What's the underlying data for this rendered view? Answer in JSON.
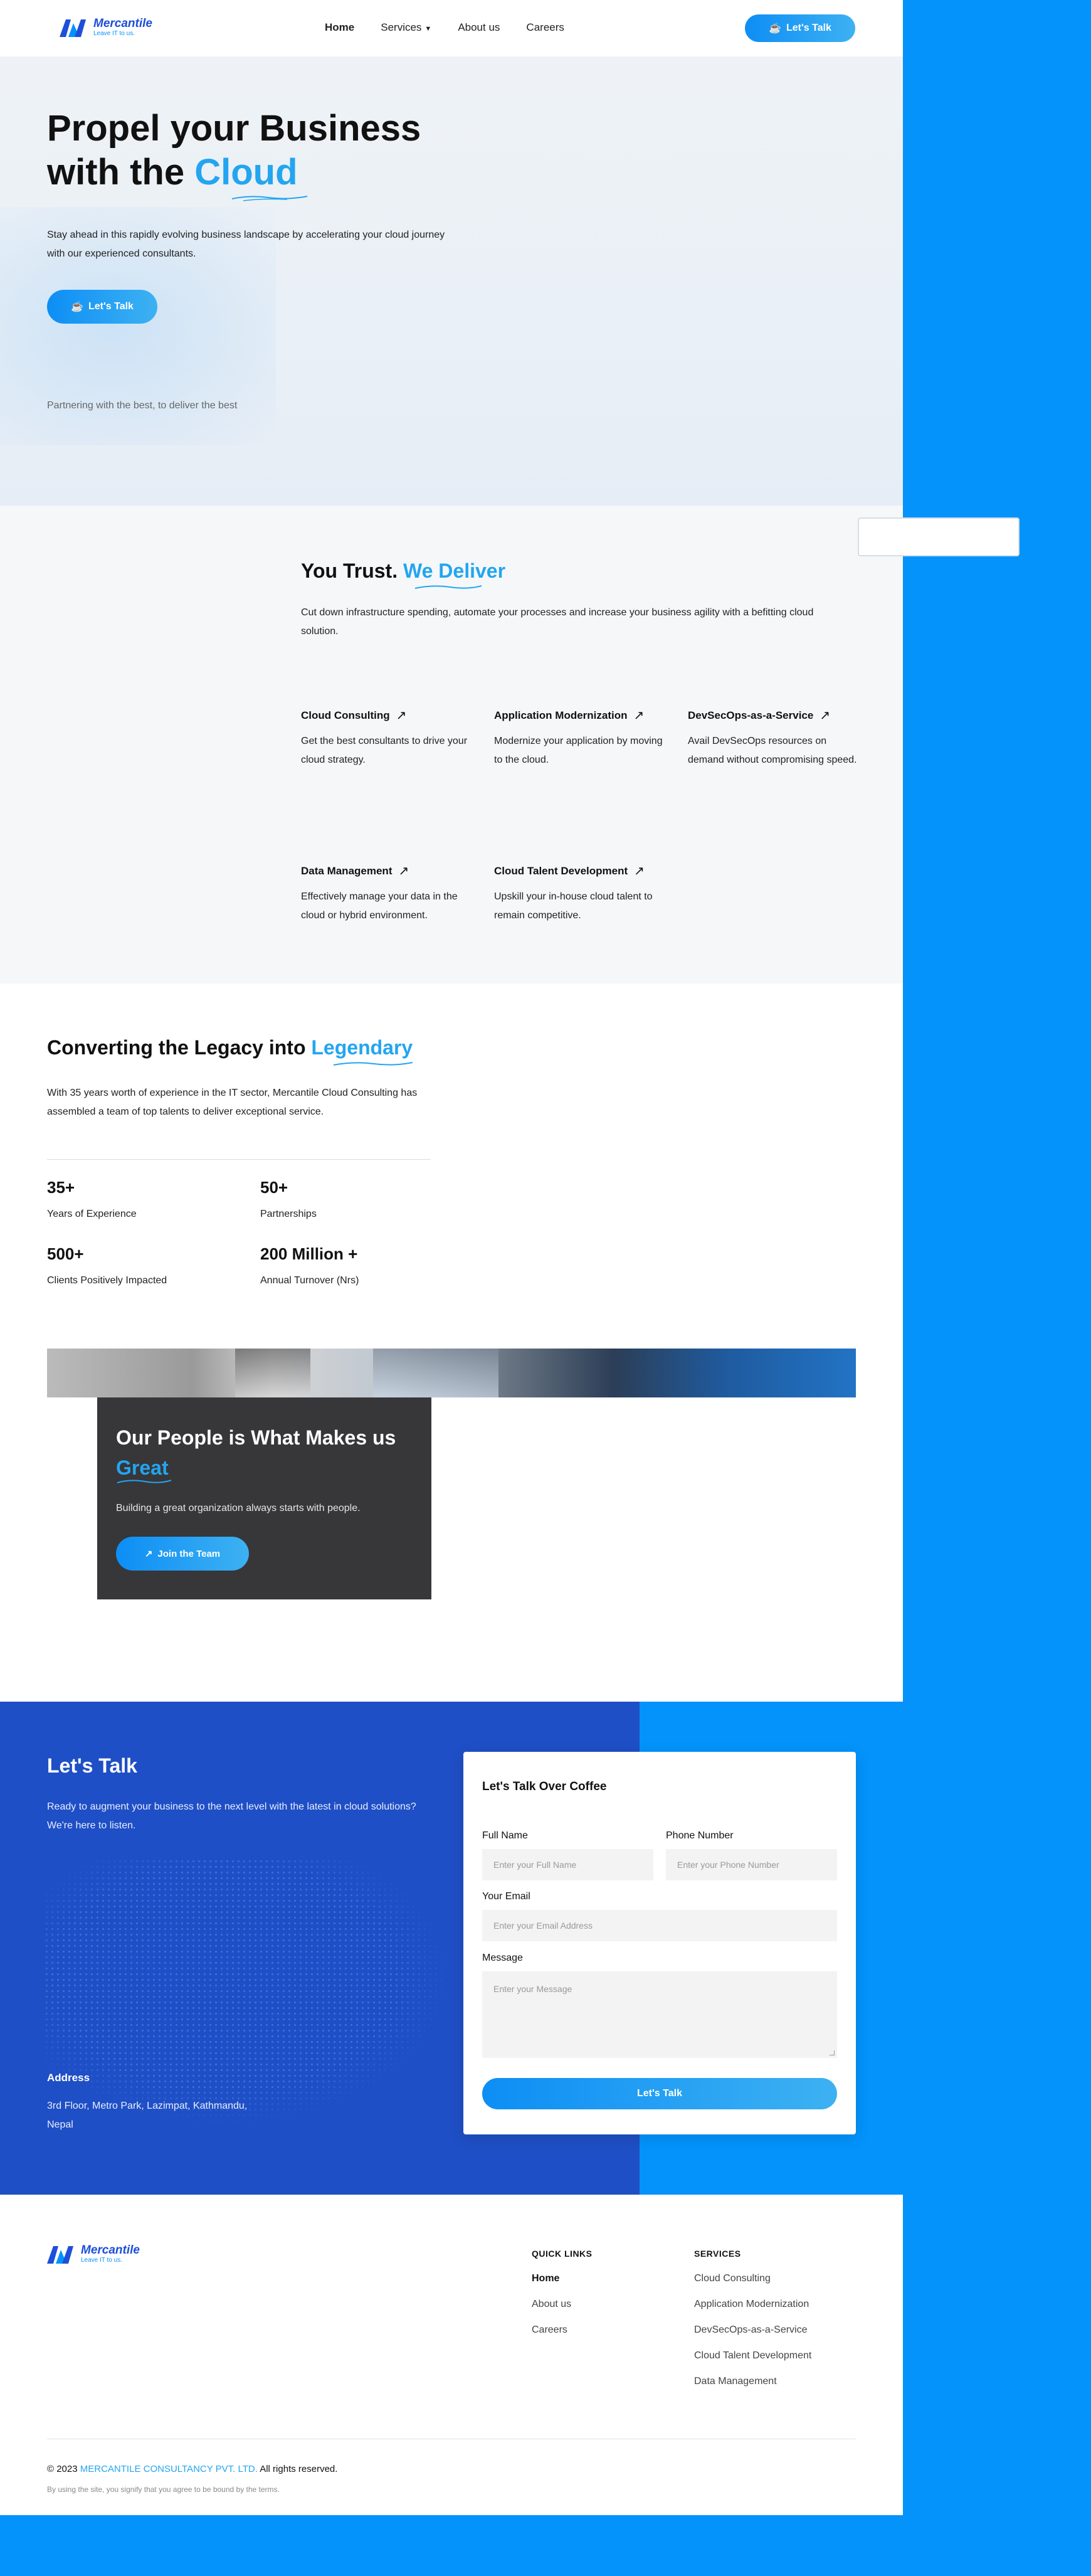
{
  "brand": {
    "name": "Mercantile",
    "tagline": "Leave IT to us."
  },
  "nav": {
    "items": [
      {
        "label": "Home"
      },
      {
        "label": "Services"
      },
      {
        "label": "About us"
      },
      {
        "label": "Careers"
      }
    ],
    "cta": "Let's Talk"
  },
  "hero": {
    "title_line1": "Propel your Business",
    "title_line2_prefix": "with the",
    "title_accent": "Cloud",
    "description": "Stay ahead in this rapidly evolving business landscape by accelerating your cloud journey with our experienced consultants.",
    "cta": "Let's Talk",
    "partner_text": "Partnering with the best, to deliver the best"
  },
  "services": {
    "title_prefix": "You Trust.",
    "title_accent": "We Deliver",
    "description": "Cut down infrastructure spending, automate your processes and increase your business agility with a befitting cloud solution.",
    "items": [
      {
        "title": "Cloud Consulting",
        "text": "Get the best consultants to drive your cloud strategy."
      },
      {
        "title": "Application Modernization",
        "text": "Modernize your application by moving to the cloud."
      },
      {
        "title": "DevSecOps-as-a-Service",
        "text": "Avail DevSecOps resources on demand without compromising speed."
      },
      {
        "title": "Data Management",
        "text": "Effectively manage your data in the cloud or hybrid environment."
      },
      {
        "title": "Cloud Talent Development",
        "text": "Upskill your in-house cloud talent to remain competitive."
      }
    ]
  },
  "legacy": {
    "title_prefix": "Converting the Legacy into",
    "title_accent": "Legendary",
    "description": "With 35 years worth of experience in the IT sector, Mercantile Cloud Consulting has assembled a team of top talents to deliver exceptional service.",
    "stats": [
      {
        "value": "35+",
        "label": "Years of Experience"
      },
      {
        "value": "50+",
        "label": "Partnerships"
      },
      {
        "value": "500+",
        "label": "Clients Positively Impacted"
      },
      {
        "value": "200 Million +",
        "label": "Annual Turnover (Nrs)"
      }
    ]
  },
  "people": {
    "title_prefix": "Our People is What Makes us",
    "title_accent": "Great",
    "description": "Building a great organization always starts with people.",
    "cta": "Join the Team"
  },
  "contact": {
    "title": "Let's Talk",
    "description": "Ready to augment your business to the next level with the latest in cloud solutions? We're here to listen.",
    "address_title": "Address",
    "address": "3rd Floor, Metro Park, Lazimpat, Kathmandu, Nepal",
    "form": {
      "title": "Let's Talk Over Coffee",
      "full_name_label": "Full Name",
      "full_name_placeholder": "Enter your Full Name",
      "phone_label": "Phone Number",
      "phone_placeholder": "Enter your Phone Number",
      "email_label": "Your Email",
      "email_placeholder": "Enter your Email Address",
      "message_label": "Message",
      "message_placeholder": "Enter your Message",
      "submit": "Let's Talk"
    }
  },
  "footer": {
    "quick_links_title": "QUICK LINKS",
    "quick_links": [
      "Home",
      "About us",
      "Careers"
    ],
    "services_title": "SERVICES",
    "services": [
      "Cloud Consulting",
      "Application Modernization",
      "DevSecOps-as-a-Service",
      "Cloud Talent Development",
      "Data Management"
    ],
    "copyright_prefix": "© 2023",
    "company": "MERCANTILE CONSULTANCY PVT. LTD.",
    "copyright_suffix": "All rights reserved.",
    "terms": "By using the site, you signify that you agree to be bound by the terms."
  },
  "colors": {
    "accent": "#23a5f0",
    "brand_blue": "#1f4fc6",
    "page_bg": "#0393fb",
    "card_dark": "#373639"
  },
  "icons": {
    "nav_cta": "coffee-icon",
    "service_arrow": "arrow-up-right-icon",
    "join": "arrow-up-right-icon",
    "services_menu": "chevron-down-icon"
  }
}
